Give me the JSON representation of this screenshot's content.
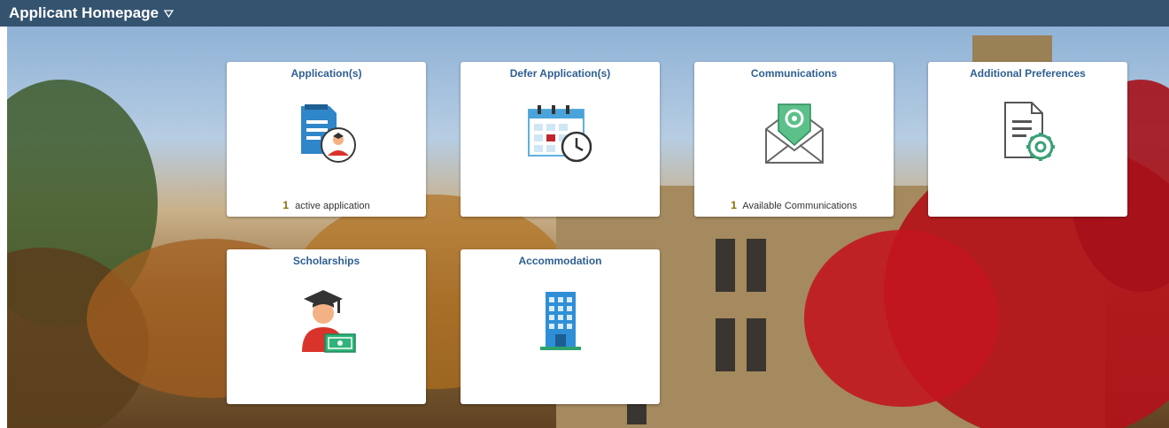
{
  "header": {
    "title": "Applicant Homepage"
  },
  "tiles": [
    {
      "title": "Application(s)",
      "count": "1",
      "footer": "active application",
      "icon": "application-document-icon"
    },
    {
      "title": "Defer Application(s)",
      "icon": "calendar-clock-icon"
    },
    {
      "title": "Communications",
      "count": "1",
      "footer": "Available Communications",
      "icon": "email-envelope-icon"
    },
    {
      "title": "Additional Preferences",
      "icon": "document-gear-icon"
    },
    {
      "title": "Scholarships",
      "icon": "graduate-student-icon"
    },
    {
      "title": "Accommodation",
      "icon": "building-icon"
    }
  ],
  "colors": {
    "header_bg": "#34536f",
    "tile_title": "#2f5f91",
    "count": "#8a6a00"
  }
}
